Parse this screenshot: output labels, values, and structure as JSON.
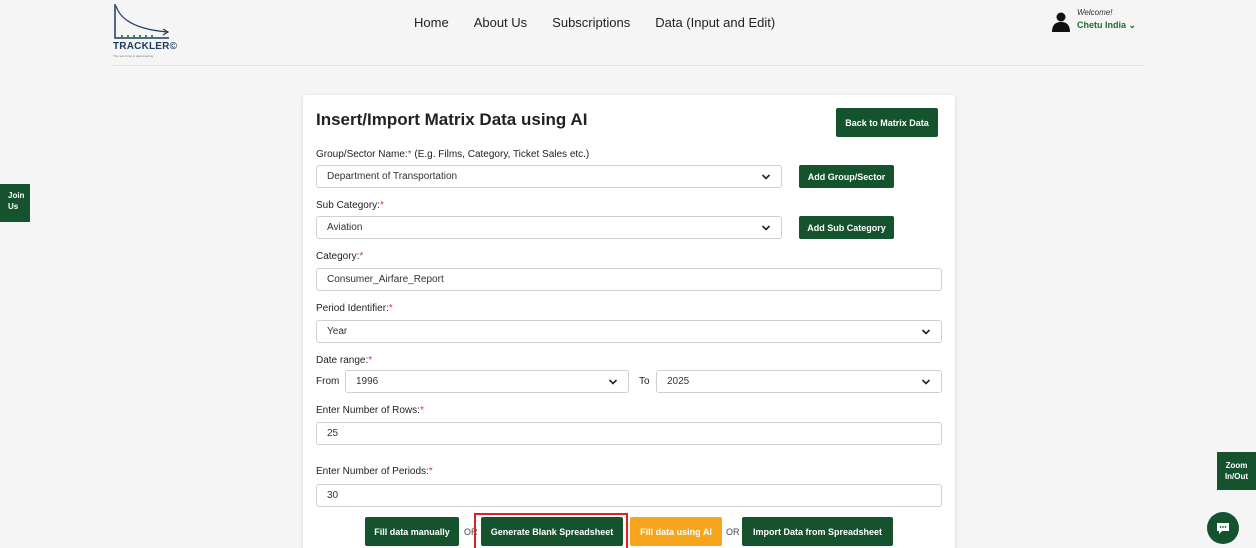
{
  "brand": {
    "name": "TRACKLER",
    "mark": "©",
    "tagline": "The new force in data tracking"
  },
  "nav": {
    "items": [
      "Home",
      "About Us",
      "Subscriptions",
      "Data (Input and Edit)"
    ]
  },
  "user": {
    "welcome": "Welcome!",
    "name": "Chetu India",
    "caret": "⌄"
  },
  "side": {
    "join_line1": "Join",
    "join_line2": "Us",
    "zoom_line1": "Zoom",
    "zoom_line2": "In/Out"
  },
  "form": {
    "title": "Insert/Import Matrix Data using AI",
    "back_label": "Back to Matrix Data",
    "group_label": "Group/Sector Name:",
    "group_hint": " (E.g. Films, Category, Ticket Sales etc.)",
    "group_value": "Department of Transportation",
    "add_group_label": "Add Group/Sector",
    "subcat_label": "Sub Category:",
    "subcat_value": "Aviation",
    "add_subcat_label": "Add Sub Category",
    "category_label": "Category:",
    "category_value": "Consumer_Airfare_Report",
    "period_label": "Period Identifier:",
    "period_value": "Year",
    "date_label": "Date range:",
    "from_label": "From",
    "from_value": "1996",
    "to_label": "To",
    "to_value": "2025",
    "rows_label": "Enter Number of Rows:",
    "rows_value": "25",
    "periods_label": "Enter Number of Periods:",
    "periods_value": "30",
    "required_mark": "*"
  },
  "actions": {
    "fill_manual": "Fill data manually",
    "or": "OR",
    "generate_blank": "Generate Blank Spreadsheet",
    "fill_ai": "Fill data using AI",
    "import": "Import Data from Spreadsheet"
  },
  "colors": {
    "primary": "#14532d",
    "ai_button": "#f7a51c",
    "highlight": "#e02020",
    "required": "#dd3333"
  }
}
